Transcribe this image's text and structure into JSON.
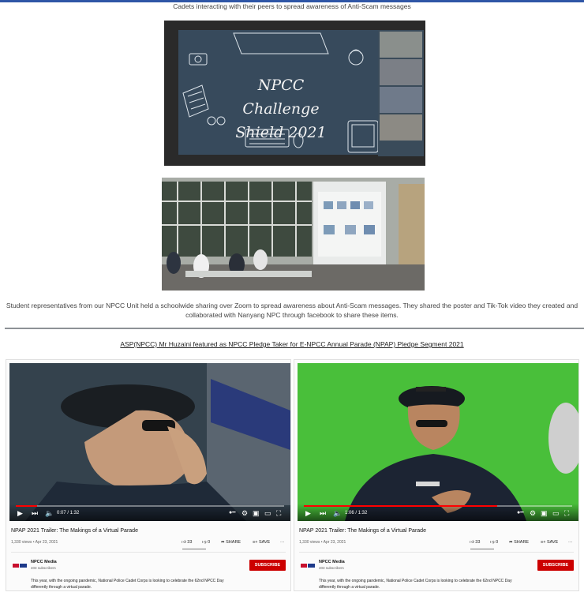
{
  "colors": {
    "accent_bar": "#2f56a6",
    "subscribe": "#cc0000",
    "progress": "#ff0000",
    "green_screen": "#4cbf3c"
  },
  "captions": {
    "top": "Cadets interacting with their peers to spread awareness of Anti-Scam messages",
    "middle": "Student representatives from our NPCC Unit held a schoolwide sharing over Zoom to spread awareness about Anti-Scam messages. They shared the poster and Tik-Tok video they created and collaborated with Nanyang NPC through facebook to share these items."
  },
  "zoom_slide": {
    "line1": "NPCC Challenge",
    "line2": "Shield 2021"
  },
  "heading_link": "ASP(NPCC) Mr Huzaini featured as NPCC Pledge Taker for E-NPCC Annual Parade (NPAP) Pledge Segment 2021",
  "videos": [
    {
      "time": "0:07 / 1:32",
      "progress": 0.08,
      "title": "NPAP 2021 Trailer: The Makings of a Virtual Parade",
      "meta": "1,330 views • Apr 23, 2021",
      "likes": "33",
      "dislikes": "0",
      "share": "SHARE",
      "save": "SAVE",
      "more": "···",
      "channel": "NPCC Media",
      "subscribers": "403 subscribers",
      "subscribe": "SUBSCRIBE",
      "description": "This year, with the ongoing pandemic, National Police Cadet Corps is looking to celebrate the 62nd NPCC Day differently through a virtual parade."
    },
    {
      "time": "1:06 / 1:32",
      "progress": 0.72,
      "title": "NPAP 2021 Trailer: The Makings of a Virtual Parade",
      "meta": "1,330 views • Apr 23, 2021",
      "likes": "33",
      "dislikes": "0",
      "share": "SHARE",
      "save": "SAVE",
      "more": "···",
      "channel": "NPCC Media",
      "subscribers": "403 subscribers",
      "subscribe": "SUBSCRIBE",
      "description": "This year, with the ongoing pandemic, National Police Cadet Corps is looking to celebrate the 62nd NPCC Day differently through a virtual parade."
    }
  ],
  "icons": {
    "play": "play-icon",
    "next": "next-icon",
    "volume": "volume-icon",
    "settings": "gear-icon",
    "miniplayer": "miniplayer-icon",
    "theater": "theater-icon",
    "fullscreen": "fullscreen-icon",
    "like": "thumbs-up-icon",
    "dislike": "thumbs-down-icon",
    "share": "share-icon",
    "save": "save-playlist-icon"
  }
}
